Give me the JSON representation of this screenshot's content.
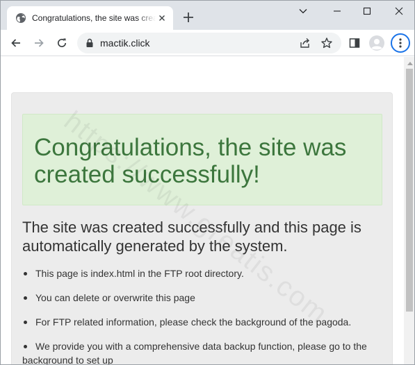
{
  "browser": {
    "tab_title": "Congratulations, the site was created successfully!",
    "url": "mactik.click"
  },
  "page": {
    "alert_heading": "Congratulations, the site was created successfully!",
    "subtitle": "The site was created successfully and this page is automatically generated by the system.",
    "bullets": [
      "This page is index.html in the FTP root directory.",
      "You can delete or overwrite this page",
      "For FTP related information, please check the background of the pagoda.",
      "We provide you with a comprehensive data backup function, please go to the background to set up"
    ]
  },
  "watermark": "https://www.greatis.com",
  "colors": {
    "alert_bg": "#dff0d8",
    "alert_text": "#3c763d",
    "panel_bg": "#ececec",
    "accent": "#1a73e8"
  },
  "icons": {
    "tab_favicon": "globe-icon",
    "back": "arrow-left-icon",
    "forward": "arrow-right-icon",
    "reload": "reload-icon",
    "lock": "lock-icon",
    "share": "share-icon",
    "bookmark": "star-icon",
    "side_panel": "side-panel-icon",
    "profile": "avatar-icon",
    "menu": "kebab-menu-icon"
  }
}
